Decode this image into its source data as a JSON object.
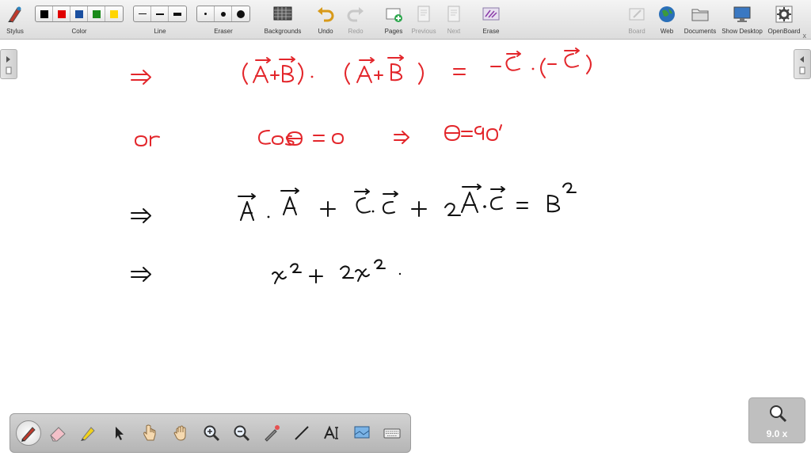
{
  "toolbar": {
    "stylus": "Stylus",
    "color": "Color",
    "line": "Line",
    "eraser": "Eraser",
    "backgrounds": "Backgrounds",
    "undo": "Undo",
    "redo": "Redo",
    "pages": "Pages",
    "previous": "Previous",
    "next": "Next",
    "erase": "Erase",
    "board": "Board",
    "web": "Web",
    "documents": "Documents",
    "show_desktop": "Show Desktop",
    "openboard": "OpenBoard",
    "close": "x"
  },
  "colors": {
    "swatches": [
      "#000000",
      "#e00000",
      "#1a4fa0",
      "#1a8a1a",
      "#ffd500"
    ],
    "ink_red": "#e3262b",
    "ink_black": "#111111"
  },
  "board": {
    "lines": [
      {
        "lhs": "⇒",
        "body": "(A⃗+B⃗)·(A⃗+B⃗) = −C⃗·(−C⃗)",
        "color": "red"
      },
      {
        "lhs": "or",
        "body": "Cos θ = 0 ⇒ θ = 90°",
        "color": "red"
      },
      {
        "lhs": "⇒",
        "body": "A⃗·A⃗ + C⃗·C⃗ + 2A⃗·C⃗ = B²",
        "color": "black"
      },
      {
        "lhs": "⇒",
        "body": "x² + 2x² ·",
        "color": "black"
      }
    ]
  },
  "zoom": {
    "label": "9.0 x"
  }
}
